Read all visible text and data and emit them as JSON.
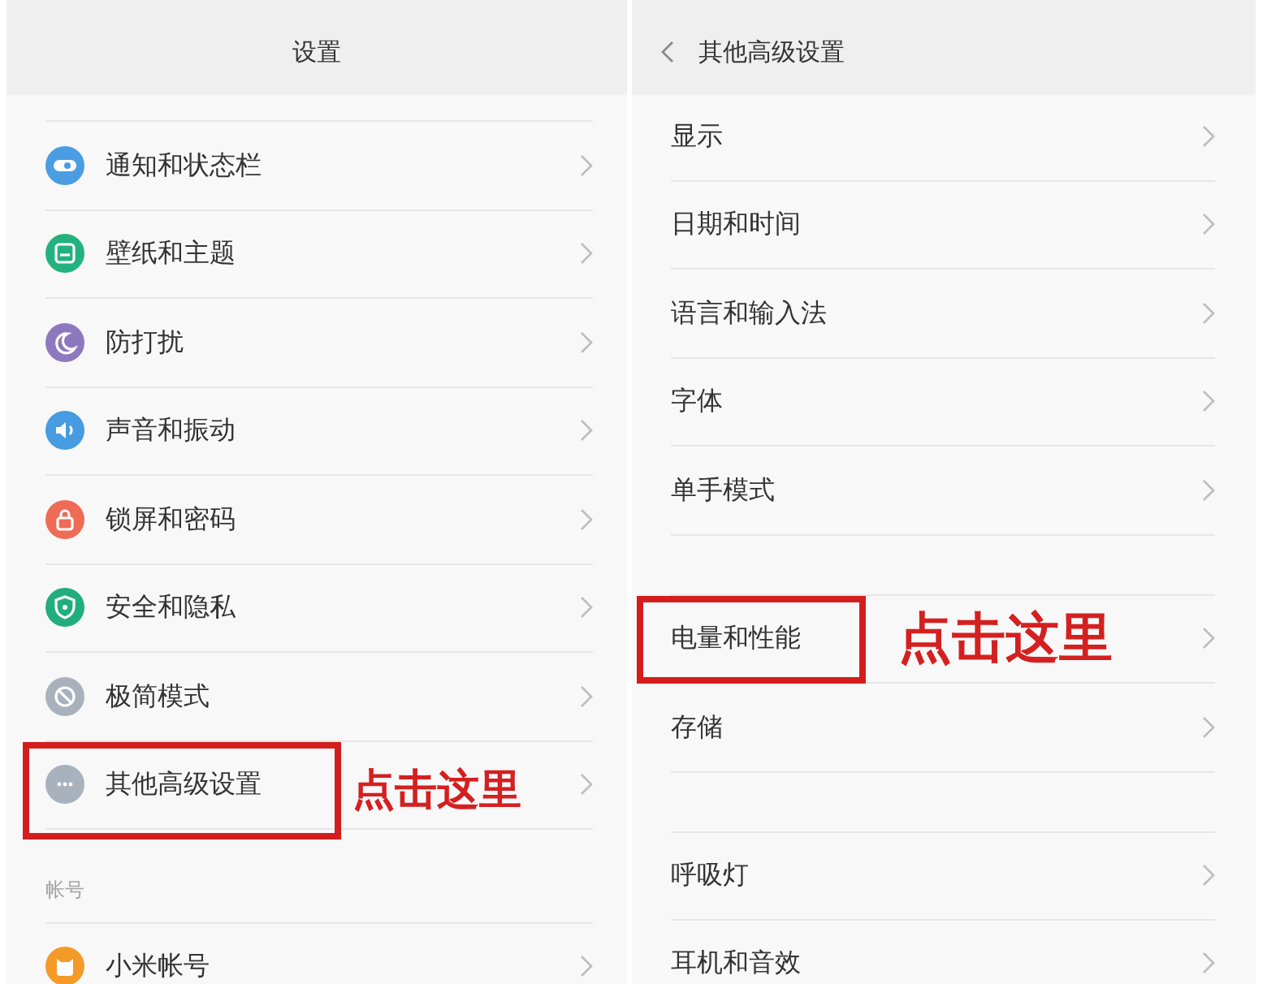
{
  "screens": [
    {
      "header": {
        "title": "设置"
      },
      "sections": [
        {
          "items": [
            {
              "label": "通知和状态栏",
              "color": "#4a9de1",
              "highlighted": false
            },
            {
              "label": "壁纸和主题",
              "color": "#23b27e",
              "highlighted": false
            },
            {
              "label": "防打扰",
              "color": "#8e78bd",
              "highlighted": false
            },
            {
              "label": "声音和振动",
              "color": "#479be0",
              "highlighted": false
            },
            {
              "label": "锁屏和密码",
              "color": "#ee6b55",
              "highlighted": false
            },
            {
              "label": "安全和隐私",
              "color": "#22ae7c",
              "highlighted": false
            },
            {
              "label": "极简模式",
              "color": "#a9b1bc",
              "highlighted": false
            },
            {
              "label": "其他高级设置",
              "color": "#a9b1bc",
              "highlighted": true,
              "annotation": "点击这里"
            }
          ]
        },
        {
          "title": "帐号",
          "items": [
            {
              "label": "小米帐号",
              "color": "#f39a28",
              "highlighted": false
            }
          ]
        }
      ]
    },
    {
      "header": {
        "title": "其他高级设置"
      },
      "sections": [
        {
          "items": [
            {
              "label": "显示",
              "highlighted": false
            },
            {
              "label": "日期和时间",
              "highlighted": false
            },
            {
              "label": "语言和输入法",
              "highlighted": false
            },
            {
              "label": "字体",
              "highlighted": false
            },
            {
              "label": "单手模式",
              "highlighted": false
            }
          ]
        },
        {
          "items": [
            {
              "label": "电量和性能",
              "highlighted": true,
              "annotation": "点击这里"
            },
            {
              "label": "存储",
              "highlighted": false
            }
          ]
        },
        {
          "items": [
            {
              "label": "呼吸灯",
              "highlighted": false
            },
            {
              "label": "耳机和音效",
              "highlighted": false
            }
          ]
        }
      ]
    }
  ]
}
